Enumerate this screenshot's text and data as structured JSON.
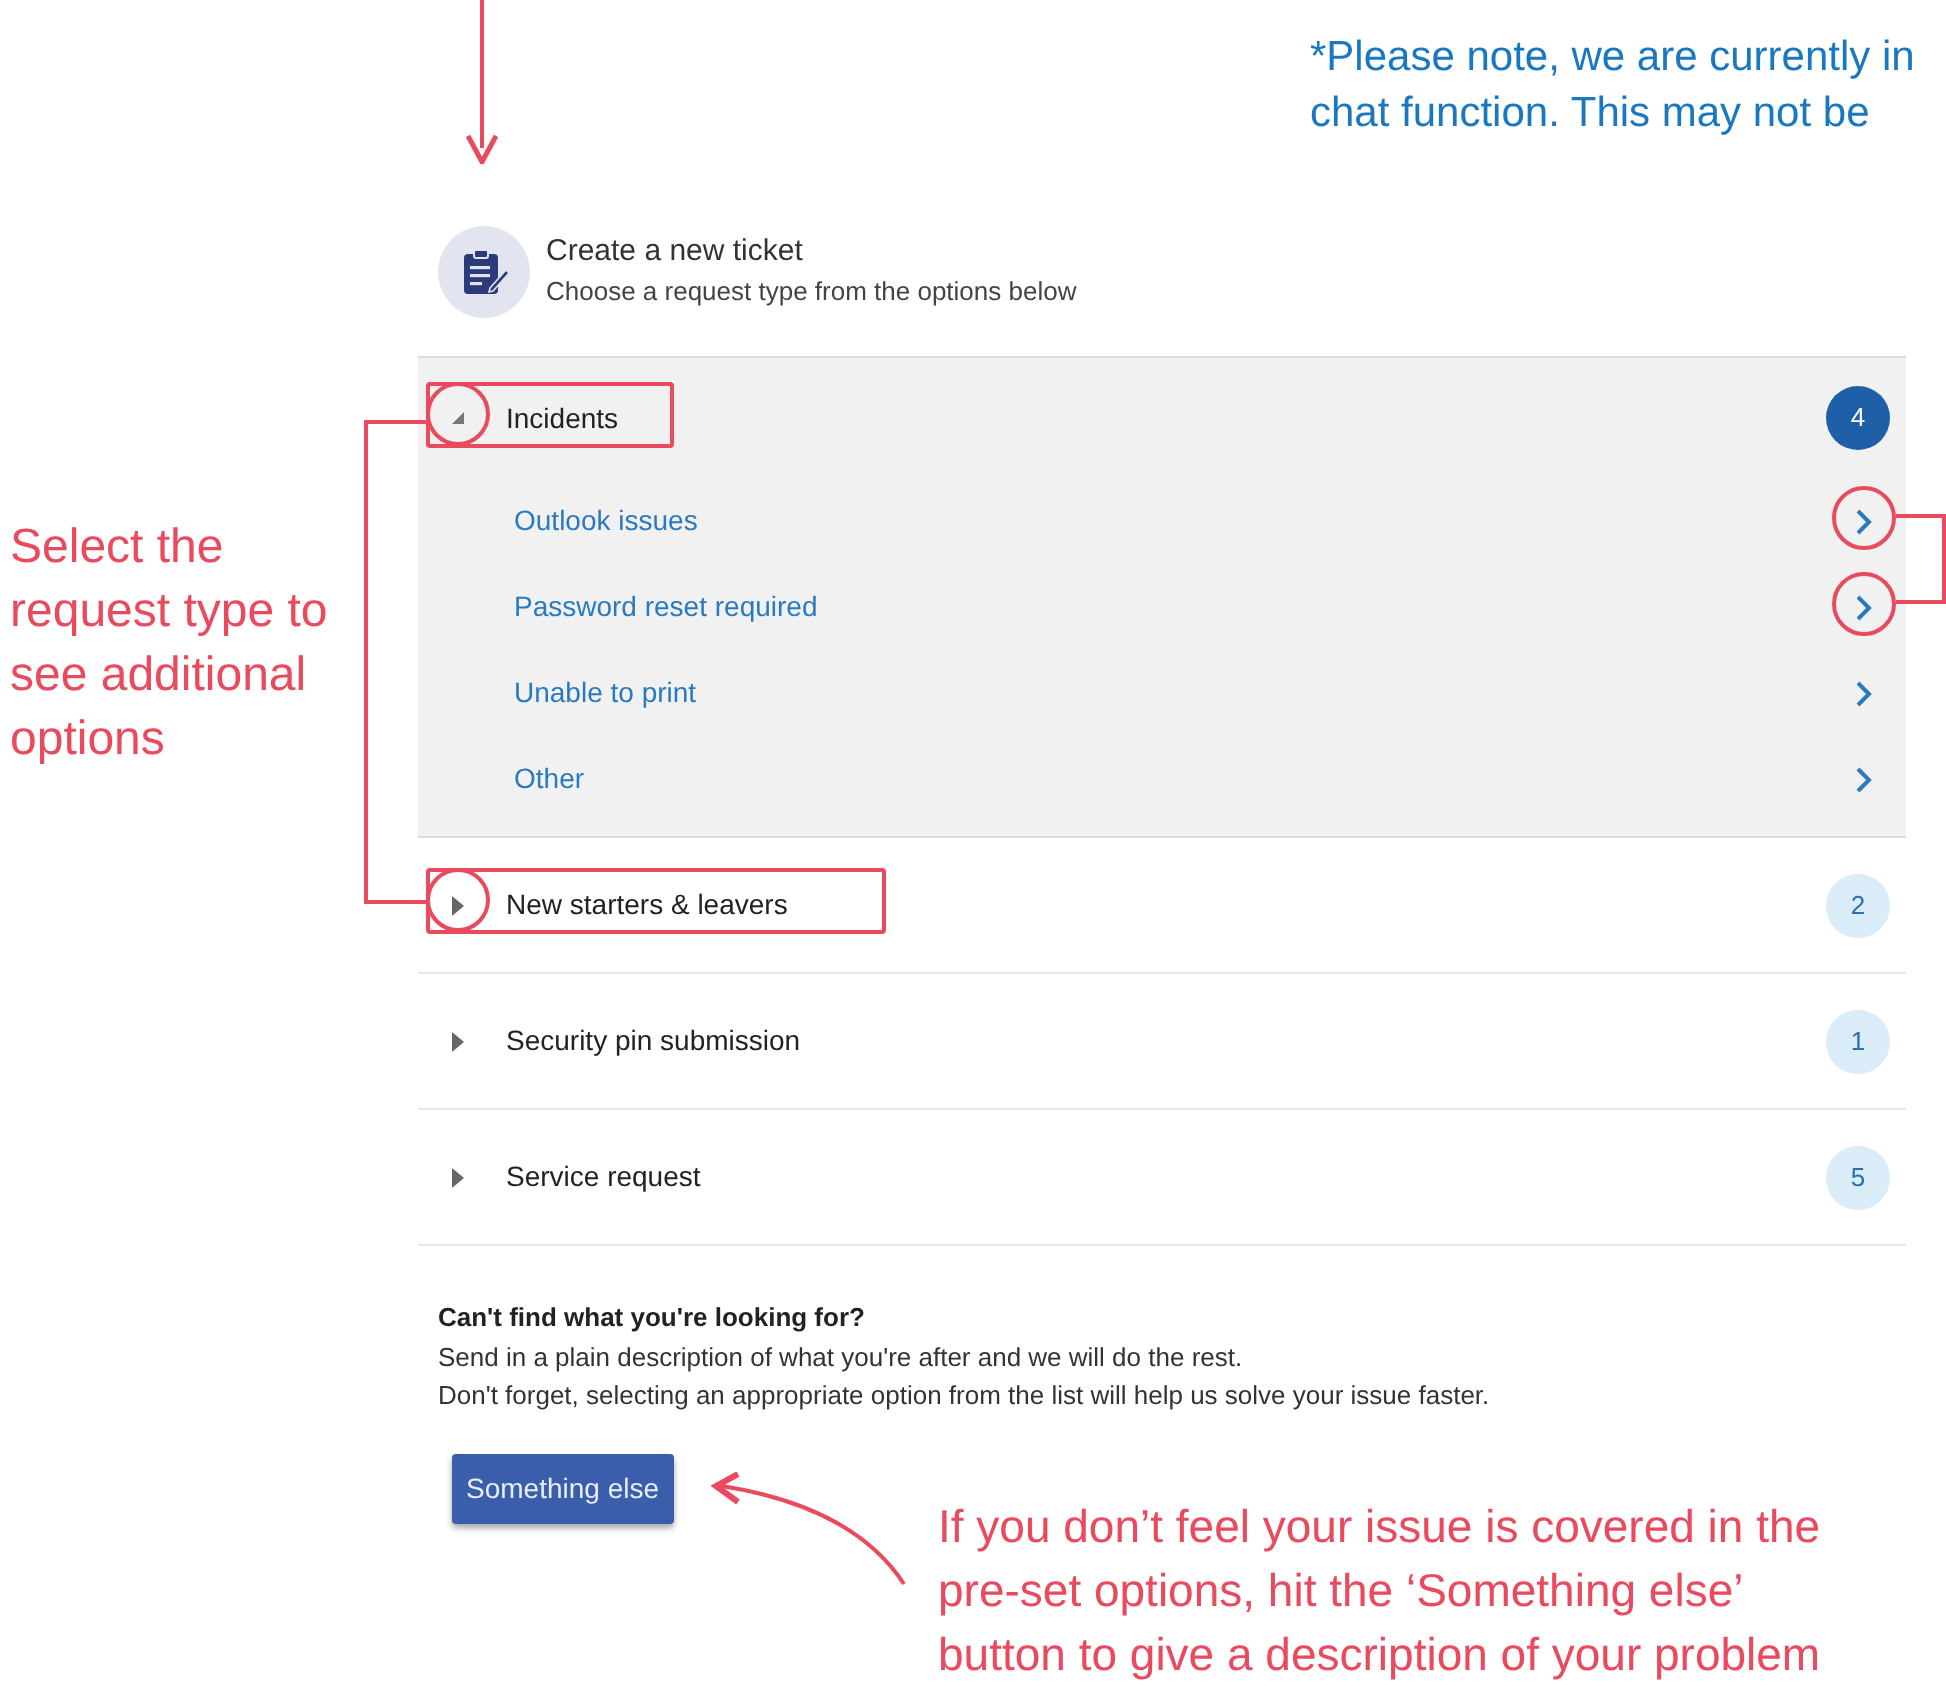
{
  "top_note": "*Please note, we are currently in\nchat function. This may not be",
  "header": {
    "title": "Create a new ticket",
    "subtitle": "Choose a request type from the options below"
  },
  "categories": [
    {
      "label": "Incidents",
      "count": "4",
      "expanded": true,
      "highlighted": true,
      "items": [
        {
          "label": "Outlook issues",
          "highlighted": true
        },
        {
          "label": "Password reset required",
          "highlighted": true
        },
        {
          "label": "Unable to print",
          "highlighted": false
        },
        {
          "label": "Other",
          "highlighted": false
        }
      ]
    },
    {
      "label": "New starters & leavers",
      "count": "2",
      "expanded": false,
      "highlighted": true
    },
    {
      "label": "Security pin submission",
      "count": "1",
      "expanded": false,
      "highlighted": false
    },
    {
      "label": "Service request",
      "count": "5",
      "expanded": false,
      "highlighted": false
    }
  ],
  "footer": {
    "title": "Can't find what you're looking for?",
    "line_1": "Send in a plain description of what you're after and we will do the rest.",
    "line_2": "Don't forget, selecting an appropriate option from the list will help us solve your issue faster.",
    "button": "Something else"
  },
  "left_note": "Select the\nrequest type to\nsee additional\noptions",
  "bottom_note": "If you don’t feel your issue is covered in the\npre-set options, hit the ‘Something else’\nbutton to give a description of your problem"
}
